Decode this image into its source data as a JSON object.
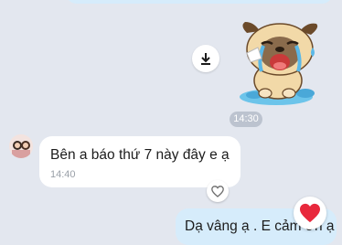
{
  "chat": {
    "sticker": {
      "icon": "crying-pug-sticker"
    },
    "download_icon": "download-icon",
    "timestamp_divider": "14:30",
    "incoming": {
      "text": "Bên a báo thứ 7 này đây e ạ",
      "time": "14:40",
      "reaction_icon": "heart-outline-icon"
    },
    "outgoing": {
      "text": "Dạ vâng ạ . E cảm ơn ạ",
      "reaction_icon": "red-heart-icon"
    }
  },
  "colors": {
    "background": "#e3e7ef",
    "outgoing_bubble": "#d6ecfb",
    "incoming_bubble": "#ffffff",
    "time_pill": "#bcc3cf",
    "heart": "#e8283c"
  }
}
